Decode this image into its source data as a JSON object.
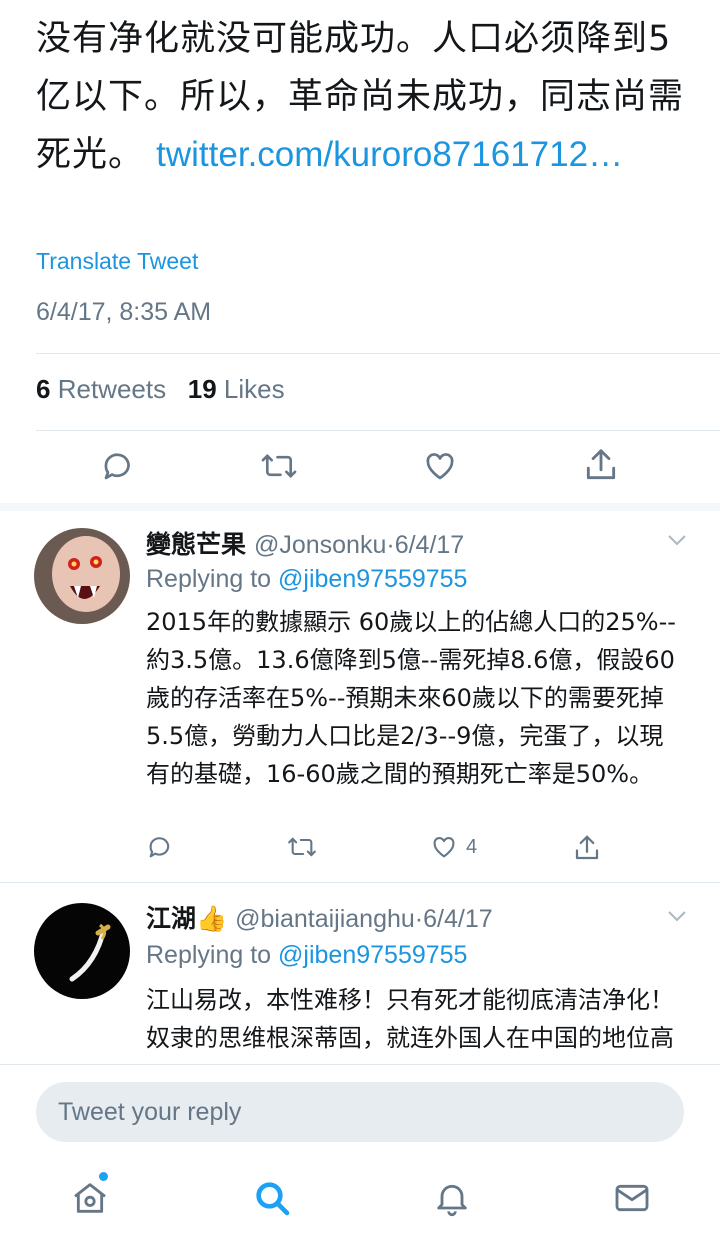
{
  "main_tweet": {
    "text": "没有净化就没可能成功。人口必须降到5亿以下。所以，革命尚未成功，同志尚需死光。",
    "link_text": "twitter.com/kuroro87161712…",
    "translate_label": "Translate Tweet",
    "timestamp": "6/4/17, 8:35 AM",
    "retweets_count": "6",
    "retweets_label": "Retweets",
    "likes_count": "19",
    "likes_label": "Likes"
  },
  "replies": [
    {
      "display_name": "變態芒果",
      "handle": "@Jonsonku",
      "separator": "·",
      "date": "6/4/17",
      "replying_label": "Replying to",
      "replying_to": "@jiben97559755",
      "text": "2015年的數據顯示 60歲以上的佔總人口的25%--約3.5億。13.6億降到5億--需死掉8.6億，假設60歲的存活率在5%--預期未來60歲以下的需要死掉5.5億，勞動力人口比是2/3--9億，完蛋了，以現有的基礎，16-60歲之間的預期死亡率是50%。",
      "like_count": "4"
    },
    {
      "display_name": "江湖",
      "emoji": "👍",
      "handle": "@biantaijianghu",
      "separator": "·",
      "date": "6/4/17",
      "replying_label": "Replying to",
      "replying_to": "@jiben97559755",
      "text": "江山易改，本性难移！只有死才能彻底清洁净化！奴隶的思维根深蒂固，就连外国人在中国的地位高自己几个档次，都没有几人能"
    }
  ],
  "compose": {
    "placeholder": "Tweet your reply"
  },
  "tabs": [
    "home-icon",
    "search-icon",
    "notifications-icon",
    "messages-icon"
  ],
  "colors": {
    "link": "#1b95e0",
    "muted": "#657786",
    "active_tab": "#1da1f2"
  }
}
